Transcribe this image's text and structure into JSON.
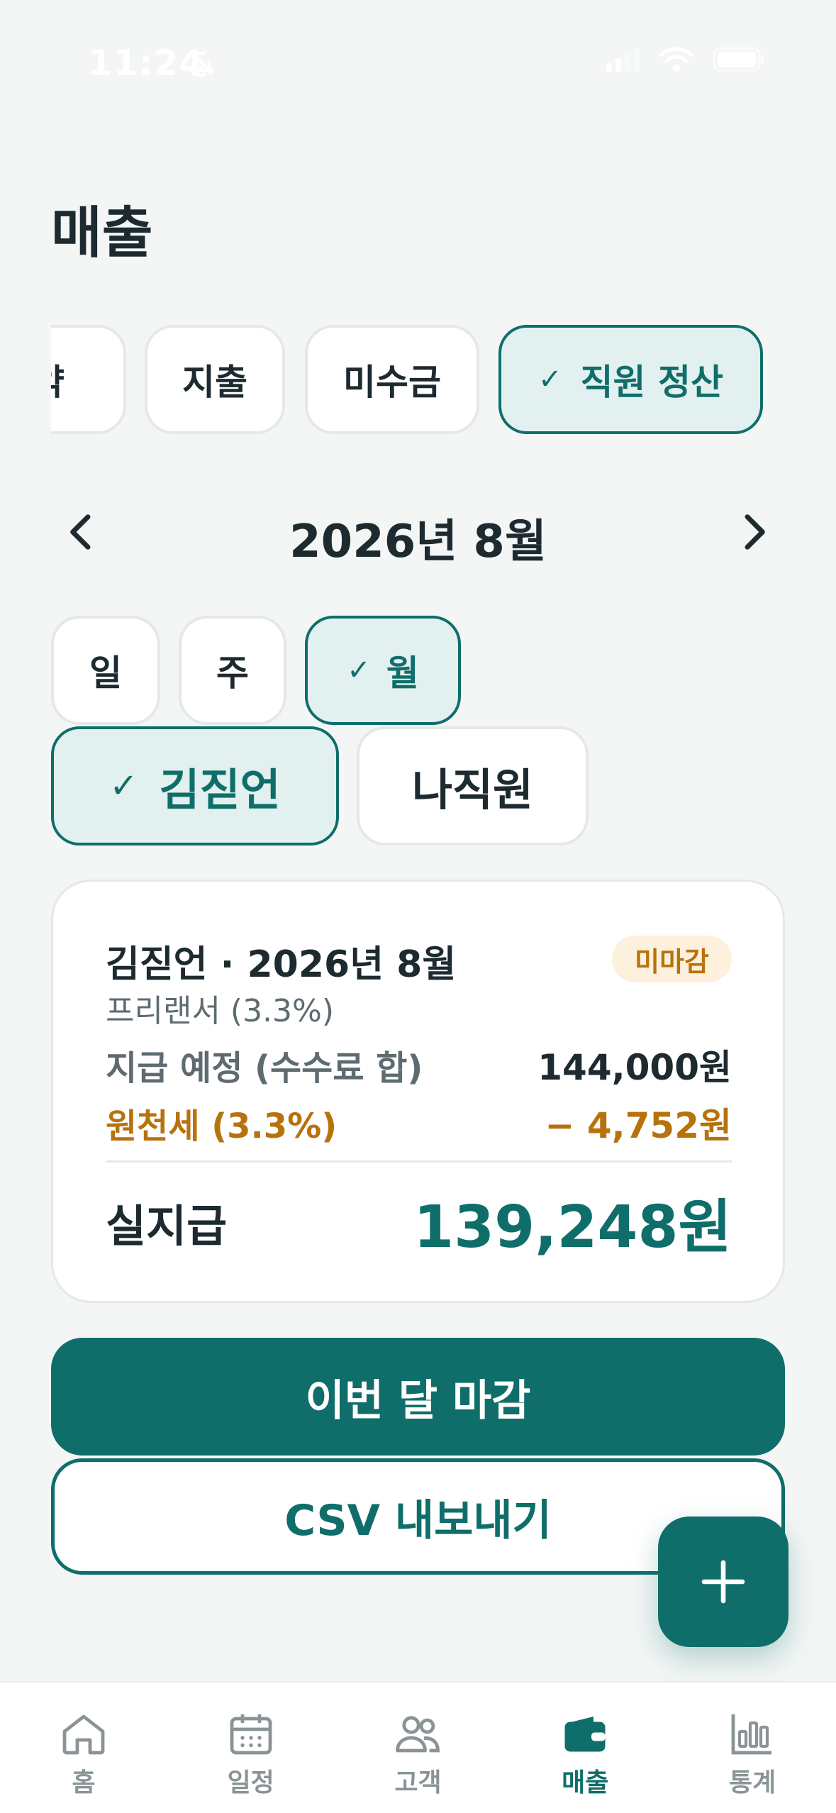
{
  "status_bar": {
    "time": "11:24"
  },
  "page": {
    "title": "매출"
  },
  "category_tabs": [
    {
      "label": "예약",
      "active": false
    },
    {
      "label": "지출",
      "active": false
    },
    {
      "label": "미수금",
      "active": false
    },
    {
      "label": "직원 정산",
      "active": true
    }
  ],
  "check_glyph": "✓",
  "month_nav": {
    "label": "2026년 8월",
    "prev_icon": "chevron-left-icon",
    "next_icon": "chevron-right-icon"
  },
  "period_tabs": [
    {
      "label": "일",
      "active": false
    },
    {
      "label": "주",
      "active": false
    },
    {
      "label": "월",
      "active": true
    }
  ],
  "staff_tabs": [
    {
      "label": "김짇언",
      "active": true
    },
    {
      "label": "나직원",
      "active": false
    }
  ],
  "summary": {
    "title": "김짇언 · 2026년 8월",
    "subtitle": "프리랜서 (3.3%)",
    "badge": "미마감",
    "payout_label": "지급 예정 (수수료 합)",
    "payout_value": "144,000원",
    "tax_label": "원천세 (3.3%)",
    "tax_value": "− 4,752원",
    "net_label": "실지급",
    "net_value": "139,248원"
  },
  "actions": {
    "close_month": "이번 달 마감",
    "export_csv": "CSV 내보내기",
    "fab_icon": "plus-icon"
  },
  "tabbar": [
    {
      "label": "홈",
      "icon": "home-icon",
      "active": false
    },
    {
      "label": "일정",
      "icon": "calendar-icon",
      "active": false
    },
    {
      "label": "고객",
      "icon": "users-icon",
      "active": false
    },
    {
      "label": "매출",
      "icon": "wallet-icon",
      "active": true
    },
    {
      "label": "통계",
      "icon": "bar-chart-icon",
      "active": false
    }
  ],
  "colors": {
    "accent": "#0f6e6a",
    "accent_light": "#e2f0ef",
    "warning": "#b8720c",
    "background": "#f3f6f5"
  }
}
